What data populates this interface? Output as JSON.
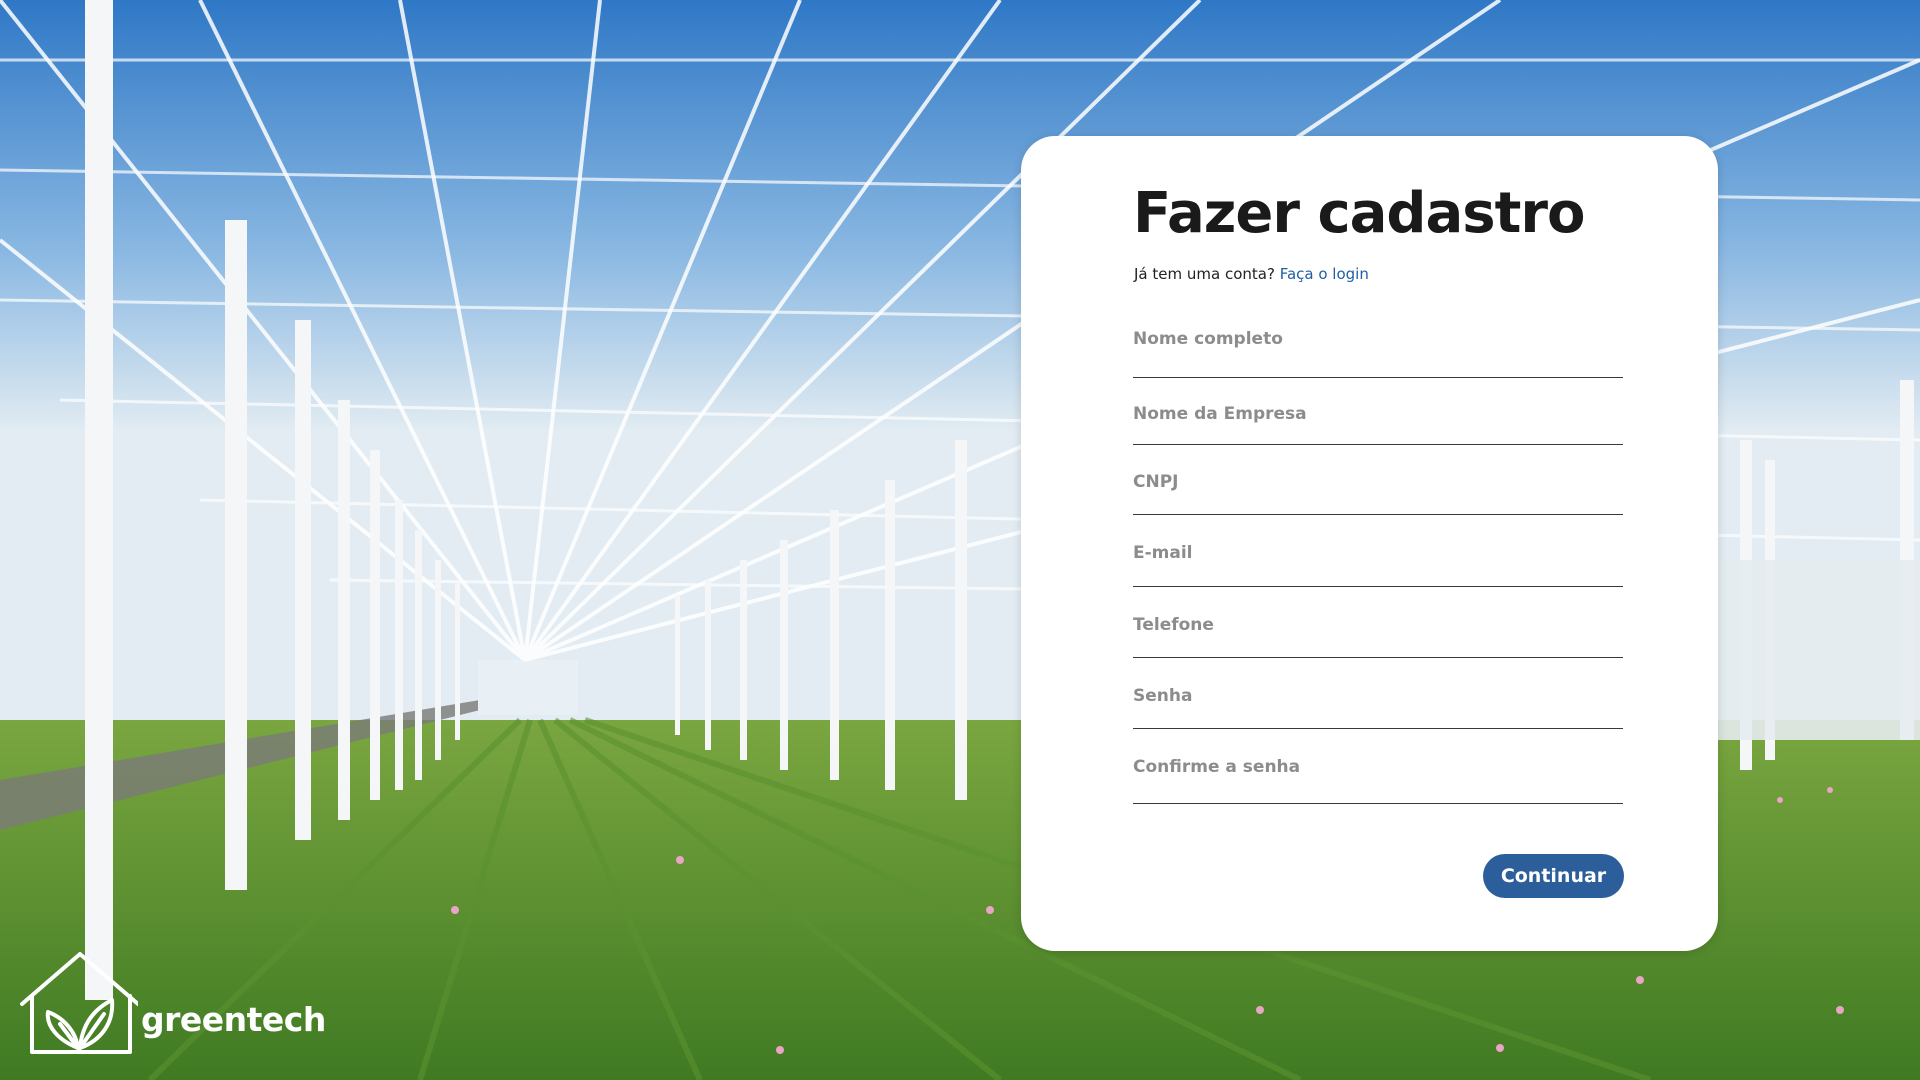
{
  "signup": {
    "title": "Fazer cadastro",
    "login_prompt": "Já tem uma conta?",
    "login_link": "Faça o login",
    "fields": [
      {
        "label": "Nome completo",
        "value": ""
      },
      {
        "label": "Nome da Empresa",
        "value": ""
      },
      {
        "label": "CNPJ",
        "value": ""
      },
      {
        "label": "E-mail",
        "value": ""
      },
      {
        "label": "Telefone",
        "value": ""
      },
      {
        "label": "Senha",
        "value": ""
      },
      {
        "label": "Confirme a senha",
        "value": ""
      }
    ],
    "continue_label": "Continuar"
  },
  "brand": {
    "name": "greentech",
    "logo_icon": "house-leaves-icon"
  },
  "background": {
    "subject": "greenhouse-icon"
  },
  "colors": {
    "accent": "#2d5e9c",
    "link": "#1f5fa5",
    "card": "#ffffff",
    "title": "#1a1a1a",
    "label": "#8c8c8c"
  }
}
